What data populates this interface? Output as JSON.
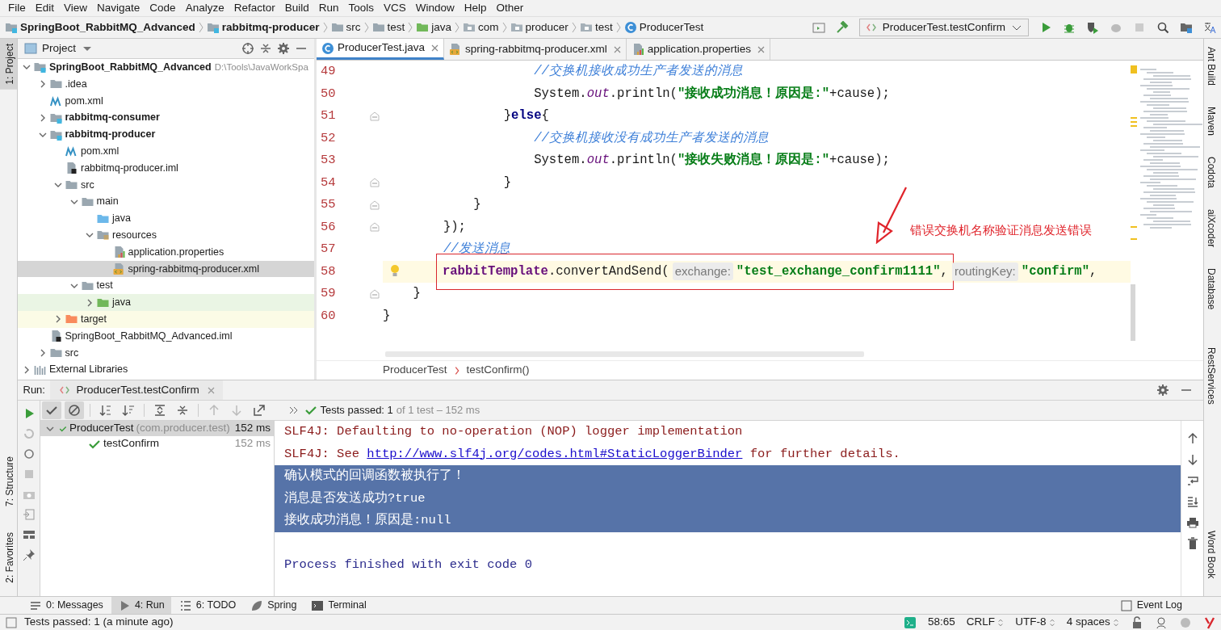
{
  "menu": [
    "File",
    "Edit",
    "View",
    "Navigate",
    "Code",
    "Analyze",
    "Refactor",
    "Build",
    "Run",
    "Tools",
    "VCS",
    "Window",
    "Help",
    "Other"
  ],
  "nav_crumbs": [
    {
      "label": "SpringBoot_RabbitMQ_Advanced",
      "kind": "module"
    },
    {
      "label": "rabbitmq-producer",
      "kind": "module"
    },
    {
      "label": "src",
      "kind": "folder"
    },
    {
      "label": "test",
      "kind": "folder"
    },
    {
      "label": "java",
      "kind": "test-folder"
    },
    {
      "label": "com",
      "kind": "package"
    },
    {
      "label": "producer",
      "kind": "package"
    },
    {
      "label": "test",
      "kind": "package"
    },
    {
      "label": "ProducerTest",
      "kind": "class"
    }
  ],
  "run_config": "ProducerTest.testConfirm",
  "left_tool_strip": [
    {
      "label": "1: Project",
      "selected": true
    },
    {
      "label": "7: Structure",
      "selected": false
    },
    {
      "label": "2: Favorites",
      "selected": false
    }
  ],
  "right_tool_strip": [
    "Ant Build",
    "Maven",
    "Codota",
    "aiXcoder",
    "Database",
    "RestServices",
    "Word Book"
  ],
  "project_panel": {
    "title": "Project",
    "tree": [
      {
        "label": "SpringBoot_RabbitMQ_Advanced",
        "kind": "module",
        "expanded": true,
        "selected": false,
        "note": "D:\\Tools\\JavaWorkSpa",
        "children": [
          {
            "label": ".idea",
            "kind": "folder",
            "expanded": false,
            "selected": false
          },
          {
            "label": "pom.xml",
            "kind": "maven",
            "selected": false
          },
          {
            "label": "rabbitmq-consumer",
            "kind": "module",
            "expanded": false,
            "selected": false
          },
          {
            "label": "rabbitmq-producer",
            "kind": "module",
            "expanded": true,
            "selected": false,
            "children": [
              {
                "label": "pom.xml",
                "kind": "maven",
                "selected": false
              },
              {
                "label": "rabbitmq-producer.iml",
                "kind": "iml",
                "selected": false
              },
              {
                "label": "src",
                "kind": "folder",
                "expanded": true,
                "selected": false,
                "children": [
                  {
                    "label": "main",
                    "kind": "folder",
                    "expanded": true,
                    "selected": false,
                    "children": [
                      {
                        "label": "java",
                        "kind": "source-folder",
                        "selected": false
                      },
                      {
                        "label": "resources",
                        "kind": "resources",
                        "expanded": true,
                        "selected": false,
                        "children": [
                          {
                            "label": "application.properties",
                            "kind": "properties",
                            "selected": false
                          },
                          {
                            "label": "spring-rabbitmq-producer.xml",
                            "kind": "xml",
                            "selected": true
                          }
                        ]
                      }
                    ]
                  },
                  {
                    "label": "test",
                    "kind": "folder",
                    "expanded": true,
                    "selected": false,
                    "children": [
                      {
                        "label": "java",
                        "kind": "test-folder",
                        "expanded": false,
                        "selected": false
                      }
                    ]
                  }
                ]
              },
              {
                "label": "target",
                "kind": "excluded",
                "expanded": false,
                "selected": false
              }
            ]
          },
          {
            "label": "SpringBoot_RabbitMQ_Advanced.iml",
            "kind": "iml",
            "selected": false
          },
          {
            "label": "src",
            "kind": "folder",
            "expanded": false,
            "selected": false
          }
        ]
      },
      {
        "label": "External Libraries",
        "kind": "libraries",
        "expanded": false,
        "selected": false
      }
    ]
  },
  "editor": {
    "tabs": [
      {
        "label": "ProducerTest.java",
        "kind": "class",
        "selected": true
      },
      {
        "label": "spring-rabbitmq-producer.xml",
        "kind": "xml",
        "selected": false
      },
      {
        "label": "application.properties",
        "kind": "properties",
        "selected": false
      }
    ],
    "lines": [
      {
        "number": "49",
        "fold": false,
        "current": false,
        "bulb": false,
        "tokens": [
          {
            "kind": "comment",
            "text": "                    //交换机接收成功生产者发送的消息"
          }
        ]
      },
      {
        "number": "50",
        "fold": false,
        "current": false,
        "bulb": false,
        "tokens": [
          {
            "kind": "plain",
            "text": "                    System."
          },
          {
            "kind": "static",
            "text": "out"
          },
          {
            "kind": "plain",
            "text": ".println("
          },
          {
            "kind": "string",
            "text": "\"接收成功消息！原因是:\""
          },
          {
            "kind": "plain",
            "text": "+cause);"
          }
        ]
      },
      {
        "number": "51",
        "fold": true,
        "current": false,
        "bulb": false,
        "tokens": [
          {
            "kind": "plain",
            "text": "                }"
          },
          {
            "kind": "keyword",
            "text": "else"
          },
          {
            "kind": "plain",
            "text": "{"
          }
        ]
      },
      {
        "number": "52",
        "fold": false,
        "current": false,
        "bulb": false,
        "tokens": [
          {
            "kind": "comment",
            "text": "                    //交换机接收没有成功生产者发送的消息"
          }
        ]
      },
      {
        "number": "53",
        "fold": false,
        "current": false,
        "bulb": false,
        "tokens": [
          {
            "kind": "plain",
            "text": "                    System."
          },
          {
            "kind": "static",
            "text": "out"
          },
          {
            "kind": "plain",
            "text": ".println("
          },
          {
            "kind": "string",
            "text": "\"接收失败消息！原因是:\""
          },
          {
            "kind": "plain",
            "text": "+cause);"
          }
        ]
      },
      {
        "number": "54",
        "fold": true,
        "current": false,
        "bulb": false,
        "tokens": [
          {
            "kind": "plain",
            "text": "                }"
          }
        ]
      },
      {
        "number": "55",
        "fold": true,
        "current": false,
        "bulb": false,
        "tokens": [
          {
            "kind": "plain",
            "text": "            }"
          }
        ]
      },
      {
        "number": "56",
        "fold": true,
        "current": false,
        "bulb": false,
        "tokens": [
          {
            "kind": "plain",
            "text": "        });"
          }
        ]
      },
      {
        "number": "57",
        "fold": false,
        "current": false,
        "bulb": false,
        "tokens": [
          {
            "kind": "comment",
            "text": "        //发送消息"
          }
        ]
      },
      {
        "number": "58",
        "fold": false,
        "current": true,
        "bulb": true,
        "tokens": [
          {
            "kind": "field",
            "text": "        rabbitTemplate",
            "boxed": true
          },
          {
            "kind": "plain",
            "text": ".convertAndSend(",
            "boxed": true
          },
          {
            "kind": "hint",
            "text": "exchange:",
            "boxed": true
          },
          {
            "kind": "string",
            "text": "\"test_exchange_confirm1111\"",
            "boxed": true
          },
          {
            "kind": "plain",
            "text": ",",
            "boxed": true
          },
          {
            "kind": "hint",
            "text": "routingKey:",
            "boxed": false
          },
          {
            "kind": "string",
            "text": "\"confirm\"",
            "boxed": false
          },
          {
            "kind": "plain",
            "text": ",",
            "boxed": false
          }
        ]
      },
      {
        "number": "59",
        "fold": true,
        "current": false,
        "bulb": false,
        "tokens": [
          {
            "kind": "plain",
            "text": "    }"
          }
        ]
      },
      {
        "number": "60",
        "fold": false,
        "current": false,
        "bulb": false,
        "tokens": [
          {
            "kind": "plain",
            "text": "}"
          }
        ]
      }
    ],
    "annotation": "错误交换机名称验证消息发送错误",
    "breadcrumb": [
      "ProducerTest",
      "testConfirm()"
    ]
  },
  "run_panel": {
    "label": "Run:",
    "tab": "ProducerTest.testConfirm",
    "toolbar": [
      {
        "kind": "show-passed",
        "pressed": true
      },
      {
        "kind": "show-ignored",
        "pressed": true
      },
      {
        "kind": "sort-alpha",
        "pressed": false
      },
      {
        "kind": "sort-duration",
        "pressed": false
      },
      {
        "kind": "expand-all",
        "pressed": false
      },
      {
        "kind": "collapse-all",
        "pressed": false
      },
      {
        "kind": "previous",
        "pressed": false
      },
      {
        "kind": "next",
        "pressed": false
      },
      {
        "kind": "export",
        "pressed": false
      }
    ],
    "status": "Tests passed: 1",
    "status_detail": "of 1 test – 152 ms",
    "tests": [
      {
        "name": "ProducerTest",
        "package": "(com.producer.test)",
        "time": "152 ms",
        "selected": true,
        "children": [
          {
            "name": "testConfirm",
            "time": "152 ms",
            "selected": false
          }
        ]
      }
    ],
    "console": [
      {
        "kind": "stderr",
        "selected": false,
        "parts": [
          {
            "kind": "text",
            "text": "SLF4J: Defaulting to no-operation (NOP) logger implementation"
          }
        ]
      },
      {
        "kind": "stderr",
        "selected": false,
        "parts": [
          {
            "kind": "text",
            "text": "SLF4J: See "
          },
          {
            "kind": "link",
            "text": "http://www.slf4j.org/codes.html#StaticLoggerBinder"
          },
          {
            "kind": "text",
            "text": " for further details."
          }
        ]
      },
      {
        "kind": "stdout",
        "selected": true,
        "parts": [
          {
            "kind": "text",
            "text": "确认模式的回调函数被执行了！"
          }
        ]
      },
      {
        "kind": "stdout",
        "selected": true,
        "parts": [
          {
            "kind": "text",
            "text": "消息是否发送成功?true"
          }
        ]
      },
      {
        "kind": "stdout",
        "selected": true,
        "parts": [
          {
            "kind": "text",
            "text": "接收成功消息！原因是:null"
          }
        ]
      },
      {
        "kind": "system",
        "selected": false,
        "parts": [
          {
            "kind": "text",
            "text": "Process finished with exit code 0"
          }
        ]
      }
    ]
  },
  "tool_tabs": [
    {
      "label": "0: Messages",
      "kind": "messages",
      "selected": false
    },
    {
      "label": "4: Run",
      "kind": "run",
      "selected": true
    },
    {
      "label": "6: TODO",
      "kind": "todo",
      "selected": false
    },
    {
      "label": "Spring",
      "kind": "spring",
      "selected": false
    },
    {
      "label": "Terminal",
      "kind": "terminal",
      "selected": false
    }
  ],
  "event_log": "Event Log",
  "status_bar": {
    "message": "Tests passed: 1 (a minute ago)",
    "position": "58:65",
    "line_separator": "CRLF",
    "encoding": "UTF-8",
    "indent": "4 spaces"
  }
}
